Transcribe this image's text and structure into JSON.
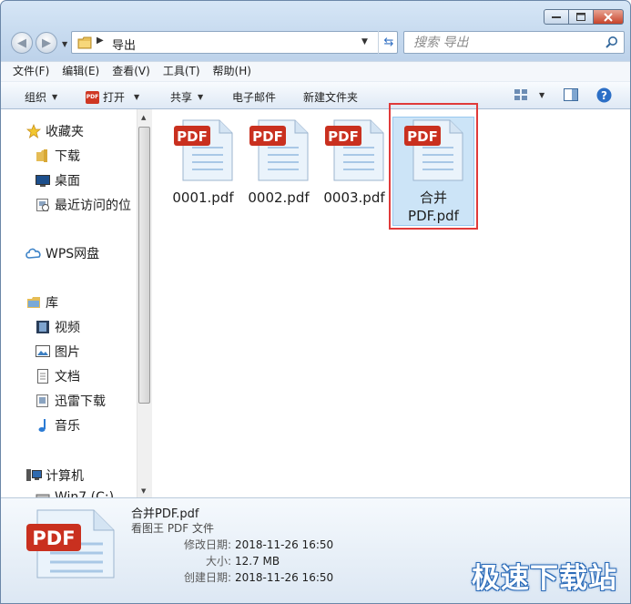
{
  "window": {
    "title": ""
  },
  "address": {
    "folder": "导出"
  },
  "search": {
    "placeholder": "搜索 导出"
  },
  "menu": [
    "文件(F)",
    "编辑(E)",
    "查看(V)",
    "工具(T)",
    "帮助(H)"
  ],
  "toolbar": {
    "organize": "组织",
    "open": "打开",
    "share": "共享",
    "email": "电子邮件",
    "new_folder": "新建文件夹"
  },
  "nav": {
    "favorites": "收藏夹",
    "downloads": "下载",
    "desktop": "桌面",
    "recent": "最近访问的位",
    "wps": "WPS网盘",
    "library": "库",
    "video": "视频",
    "pictures": "图片",
    "docs": "文档",
    "xunlei": "迅雷下载",
    "music": "音乐",
    "computer": "计算机",
    "drive": "Win7 (C:)"
  },
  "files": [
    {
      "name": "0001.pdf",
      "icon": "pdf-file-icon",
      "selected": false
    },
    {
      "name": "0002.pdf",
      "icon": "pdf-file-icon",
      "selected": false
    },
    {
      "name": "0003.pdf",
      "icon": "pdf-file-icon",
      "selected": false
    },
    {
      "name": "合并PDF.pdf",
      "icon": "pdf-file-icon",
      "selected": true
    }
  ],
  "files_label": {
    "icon_text": "PDF",
    "last_line1": "合并",
    "last_line2": "PDF.pdf"
  },
  "details": {
    "name": "合并PDF.pdf",
    "type": "看图王 PDF 文件",
    "modified_label": "修改日期:",
    "modified": "2018-11-26 16:50",
    "size_label": "大小:",
    "size": "12.7 MB",
    "created_label": "创建日期:",
    "created": "2018-11-26 16:50"
  },
  "watermark": "极速下载站",
  "colors": {
    "selection": "#cce4f7",
    "highlight_box": "#e03a3a",
    "pdf_red": "#cf3723"
  }
}
